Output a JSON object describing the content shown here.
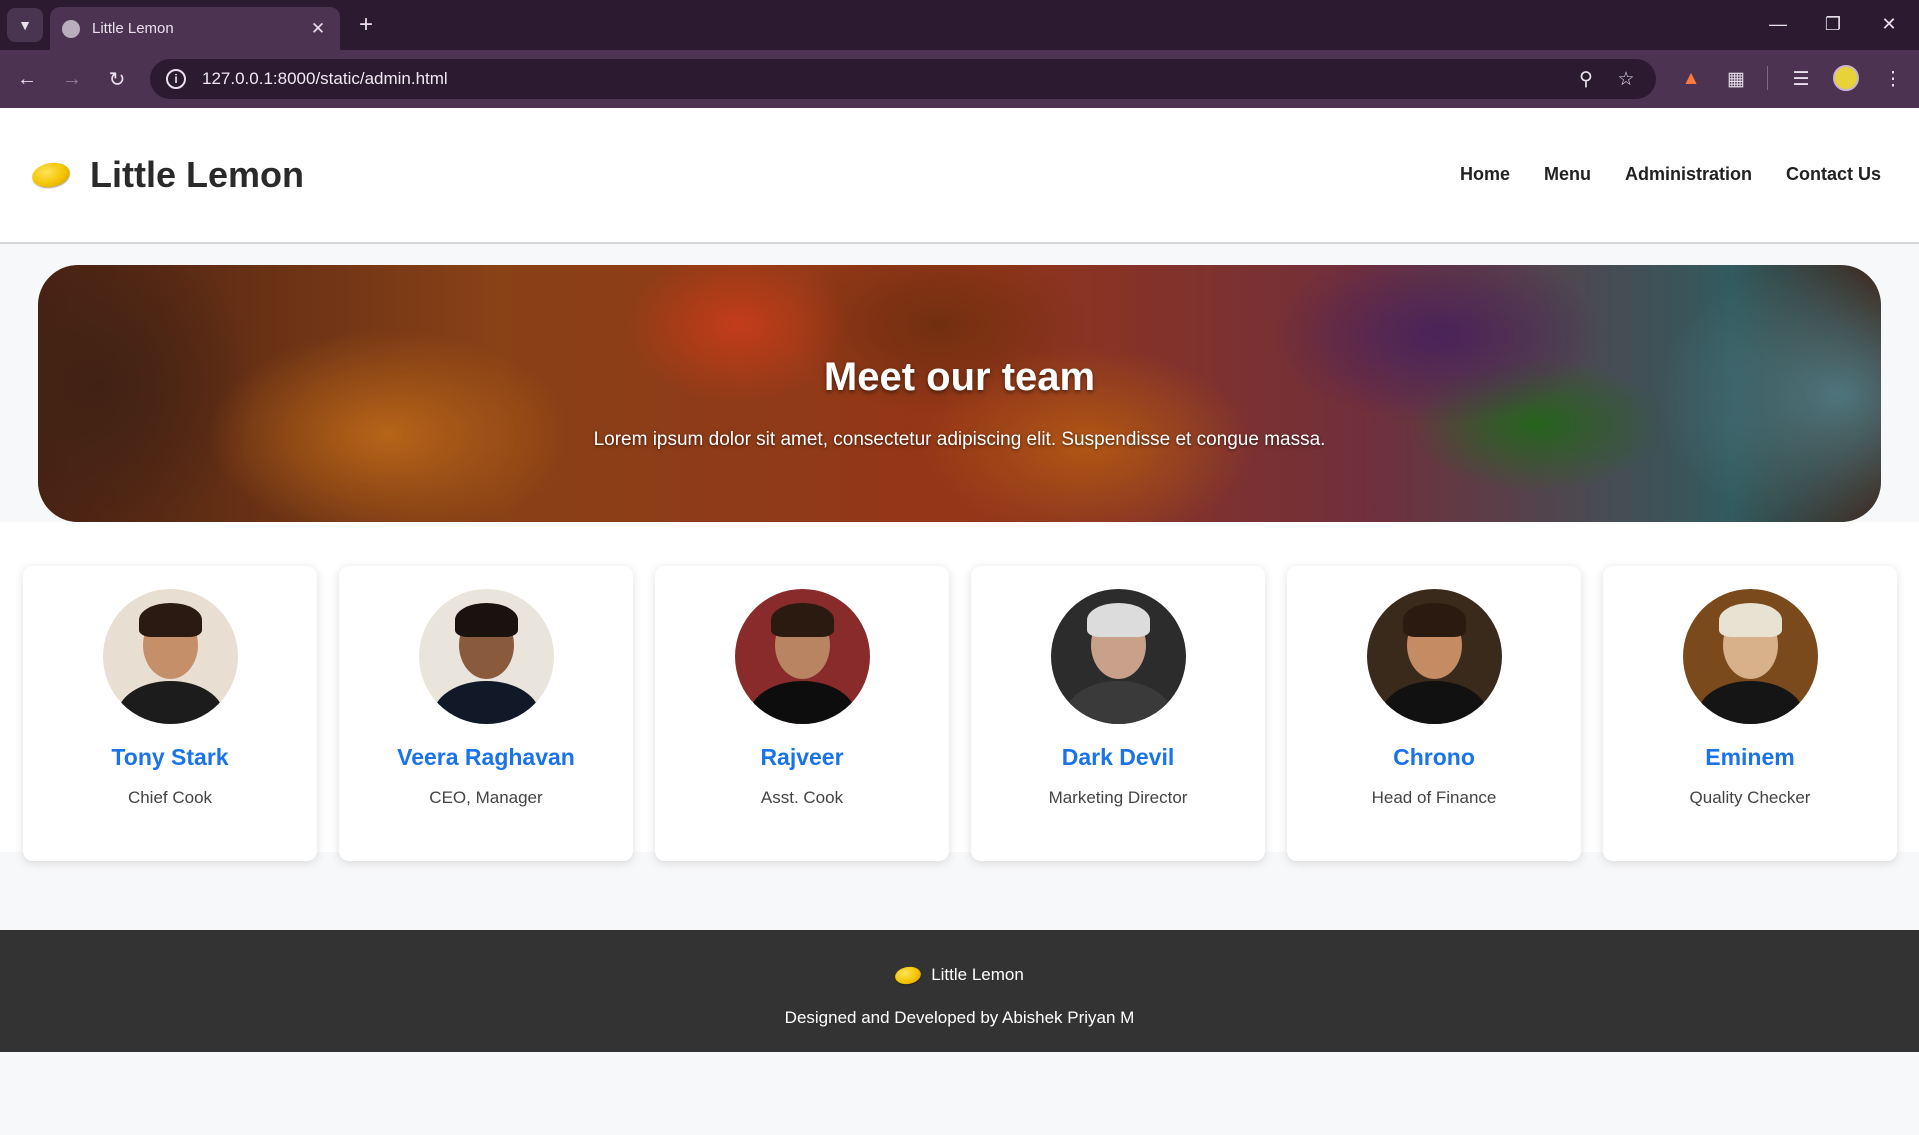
{
  "browser": {
    "tab_title": "Little Lemon",
    "url": "127.0.0.1:8000/static/admin.html"
  },
  "header": {
    "brand_name": "Little Lemon",
    "nav": [
      "Home",
      "Menu",
      "Administration",
      "Contact Us"
    ]
  },
  "hero": {
    "title": "Meet our team",
    "subtitle": "Lorem ipsum dolor sit amet, consectetur adipiscing elit. Suspendisse et congue massa."
  },
  "team": [
    {
      "name": "Tony Stark",
      "role": "Chief Cook",
      "bg": "#e8dfd2"
    },
    {
      "name": "Veera Raghavan",
      "role": "CEO, Manager",
      "bg": "#e9e4dc"
    },
    {
      "name": "Rajveer",
      "role": "Asst. Cook",
      "bg": "#8a2b2b"
    },
    {
      "name": "Dark Devil",
      "role": "Marketing Director",
      "bg": "#2c2c2c"
    },
    {
      "name": "Chrono",
      "role": "Head of Finance",
      "bg": "#3a2a1c"
    },
    {
      "name": "Eminem",
      "role": "Quality Checker",
      "bg": "#7a4a1c"
    }
  ],
  "footer": {
    "brand": "Little Lemon",
    "credit": "Designed and Developed by Abishek Priyan M"
  },
  "colors": {
    "accent": "#1a73e8",
    "footer_bg": "#333333"
  }
}
